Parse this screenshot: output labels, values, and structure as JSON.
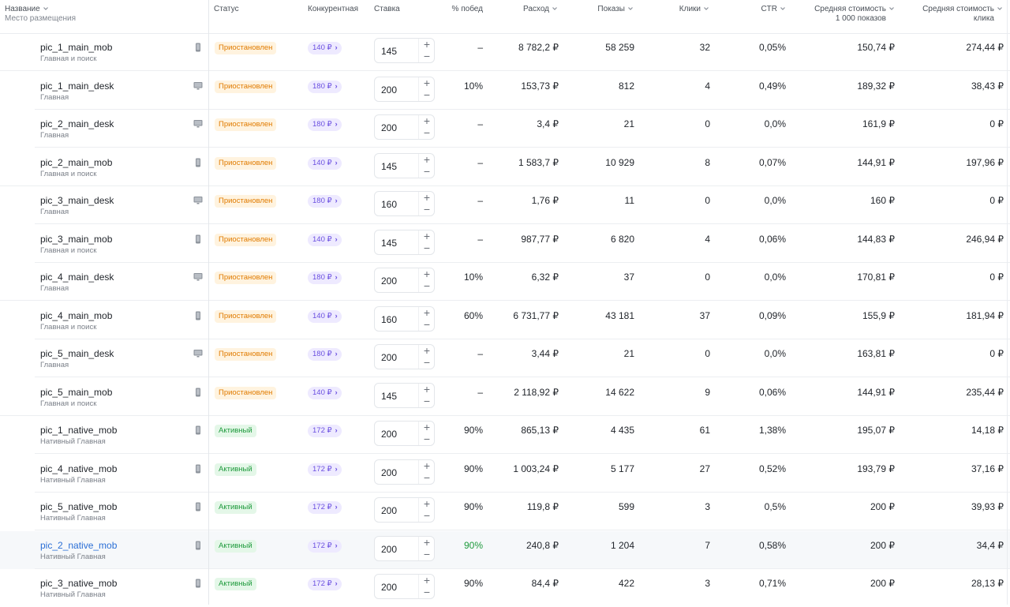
{
  "headers": {
    "name": "Название",
    "placement": "Место размещения",
    "status": "Статус",
    "competitive": "Конкурентная",
    "bid": "Ставка",
    "wins": "% побед",
    "spend": "Расход",
    "impressions": "Показы",
    "clicks": "Клики",
    "ctr": "CTR",
    "cpm_line1": "Средняя стоимость",
    "cpm_line2": "1 000 показов",
    "cpc_line1": "Средняя стоимость",
    "cpc_line2": "клика"
  },
  "colors": {
    "paused_text": "#e07b00",
    "paused_bg": "#fff3df",
    "active_text": "#1e9a3c",
    "active_bg": "#e4f7e8",
    "competitive_text": "#6a4fe0",
    "competitive_bg": "#eeeaff",
    "link": "#2b6fd6"
  },
  "rows": [
    {
      "name": "pic_1_main_mob",
      "placement": "Главная и поиск",
      "device": "phone-icon",
      "status": "Приостановлен",
      "status_kind": "paused",
      "competitive": "140 ₽",
      "bid": "145",
      "plus": "+",
      "minus": "−",
      "wins": "–",
      "spend": "8 782,2 ₽",
      "impressions": "58 259",
      "clicks": "32",
      "ctr": "0,05%",
      "cpm": "150,74 ₽",
      "cpc": "274,44 ₽"
    },
    {
      "name": "pic_1_main_desk",
      "placement": "Главная",
      "device": "monitor-icon",
      "status": "Приостановлен",
      "status_kind": "paused",
      "competitive": "180 ₽",
      "bid": "200",
      "plus": "+",
      "minus": "−",
      "wins": "10%",
      "spend": "153,73 ₽",
      "impressions": "812",
      "clicks": "4",
      "ctr": "0,49%",
      "cpm": "189,32 ₽",
      "cpc": "38,43 ₽"
    },
    {
      "name": "pic_2_main_desk",
      "placement": "Главная",
      "device": "monitor-icon",
      "status": "Приостановлен",
      "status_kind": "paused",
      "competitive": "180 ₽",
      "bid": "200",
      "plus": "+",
      "minus": "−",
      "wins": "–",
      "spend": "3,4 ₽",
      "impressions": "21",
      "clicks": "0",
      "ctr": "0,0%",
      "cpm": "161,9 ₽",
      "cpc": "0 ₽"
    },
    {
      "name": "pic_2_main_mob",
      "placement": "Главная и поиск",
      "device": "phone-icon",
      "status": "Приостановлен",
      "status_kind": "paused",
      "competitive": "140 ₽",
      "bid": "145",
      "plus": "+",
      "minus": "−",
      "wins": "–",
      "spend": "1 583,7 ₽",
      "impressions": "10 929",
      "clicks": "8",
      "ctr": "0,07%",
      "cpm": "144,91 ₽",
      "cpc": "197,96 ₽"
    },
    {
      "name": "pic_3_main_desk",
      "placement": "Главная",
      "device": "monitor-icon",
      "status": "Приостановлен",
      "status_kind": "paused",
      "competitive": "180 ₽",
      "bid": "160",
      "plus": "+",
      "minus": "−",
      "wins": "–",
      "spend": "1,76 ₽",
      "impressions": "11",
      "clicks": "0",
      "ctr": "0,0%",
      "cpm": "160 ₽",
      "cpc": "0 ₽"
    },
    {
      "name": "pic_3_main_mob",
      "placement": "Главная и поиск",
      "device": "phone-icon",
      "status": "Приостановлен",
      "status_kind": "paused",
      "competitive": "140 ₽",
      "bid": "145",
      "plus": "+",
      "minus": "−",
      "wins": "–",
      "spend": "987,77 ₽",
      "impressions": "6 820",
      "clicks": "4",
      "ctr": "0,06%",
      "cpm": "144,83 ₽",
      "cpc": "246,94 ₽"
    },
    {
      "name": "pic_4_main_desk",
      "placement": "Главная",
      "device": "monitor-icon",
      "status": "Приостановлен",
      "status_kind": "paused",
      "competitive": "180 ₽",
      "bid": "200",
      "plus": "+",
      "minus": "−",
      "wins": "10%",
      "spend": "6,32 ₽",
      "impressions": "37",
      "clicks": "0",
      "ctr": "0,0%",
      "cpm": "170,81 ₽",
      "cpc": "0 ₽"
    },
    {
      "name": "pic_4_main_mob",
      "placement": "Главная и поиск",
      "device": "phone-icon",
      "status": "Приостановлен",
      "status_kind": "paused",
      "competitive": "140 ₽",
      "bid": "160",
      "plus": "+",
      "minus": "−",
      "wins": "60%",
      "spend": "6 731,77 ₽",
      "impressions": "43 181",
      "clicks": "37",
      "ctr": "0,09%",
      "cpm": "155,9 ₽",
      "cpc": "181,94 ₽"
    },
    {
      "name": "pic_5_main_desk",
      "placement": "Главная",
      "device": "monitor-icon",
      "status": "Приостановлен",
      "status_kind": "paused",
      "competitive": "180 ₽",
      "bid": "200",
      "plus": "+",
      "minus": "−",
      "wins": "–",
      "spend": "3,44 ₽",
      "impressions": "21",
      "clicks": "0",
      "ctr": "0,0%",
      "cpm": "163,81 ₽",
      "cpc": "0 ₽"
    },
    {
      "name": "pic_5_main_mob",
      "placement": "Главная и поиск",
      "device": "phone-icon",
      "status": "Приостановлен",
      "status_kind": "paused",
      "competitive": "140 ₽",
      "bid": "145",
      "plus": "+",
      "minus": "−",
      "wins": "–",
      "spend": "2 118,92 ₽",
      "impressions": "14 622",
      "clicks": "9",
      "ctr": "0,06%",
      "cpm": "144,91 ₽",
      "cpc": "235,44 ₽"
    },
    {
      "name": "pic_1_native_mob",
      "placement": "Нативный Главная",
      "device": "phone-icon",
      "status": "Активный",
      "status_kind": "active",
      "competitive": "172 ₽",
      "bid": "200",
      "plus": "+",
      "minus": "−",
      "wins": "90%",
      "spend": "865,13 ₽",
      "impressions": "4 435",
      "clicks": "61",
      "ctr": "1,38%",
      "cpm": "195,07 ₽",
      "cpc": "14,18 ₽"
    },
    {
      "name": "pic_4_native_mob",
      "placement": "Нативный Главная",
      "device": "phone-icon",
      "status": "Активный",
      "status_kind": "active",
      "competitive": "172 ₽",
      "bid": "200",
      "plus": "+",
      "minus": "−",
      "wins": "90%",
      "spend": "1 003,24 ₽",
      "impressions": "5 177",
      "clicks": "27",
      "ctr": "0,52%",
      "cpm": "193,79 ₽",
      "cpc": "37,16 ₽"
    },
    {
      "name": "pic_5_native_mob",
      "placement": "Нативный Главная",
      "device": "phone-icon",
      "status": "Активный",
      "status_kind": "active",
      "competitive": "172 ₽",
      "bid": "200",
      "plus": "+",
      "minus": "−",
      "wins": "90%",
      "spend": "119,8 ₽",
      "impressions": "599",
      "clicks": "3",
      "ctr": "0,5%",
      "cpm": "200 ₽",
      "cpc": "39,93 ₽"
    },
    {
      "name": "pic_2_native_mob",
      "placement": "Нативный Главная",
      "device": "phone-icon",
      "status": "Активный",
      "status_kind": "active",
      "competitive": "172 ₽",
      "bid": "200",
      "plus": "+",
      "minus": "−",
      "wins": "90%",
      "spend": "240,8 ₽",
      "impressions": "1 204",
      "clicks": "7",
      "ctr": "0,58%",
      "cpm": "200 ₽",
      "cpc": "34,4 ₽",
      "highlighted": true
    },
    {
      "name": "pic_3_native_mob",
      "placement": "Нативный Главная",
      "device": "phone-icon",
      "status": "Активный",
      "status_kind": "active",
      "competitive": "172 ₽",
      "bid": "200",
      "plus": "+",
      "minus": "−",
      "wins": "90%",
      "spend": "84,4 ₽",
      "impressions": "422",
      "clicks": "3",
      "ctr": "0,71%",
      "cpm": "200 ₽",
      "cpc": "28,13 ₽"
    }
  ]
}
